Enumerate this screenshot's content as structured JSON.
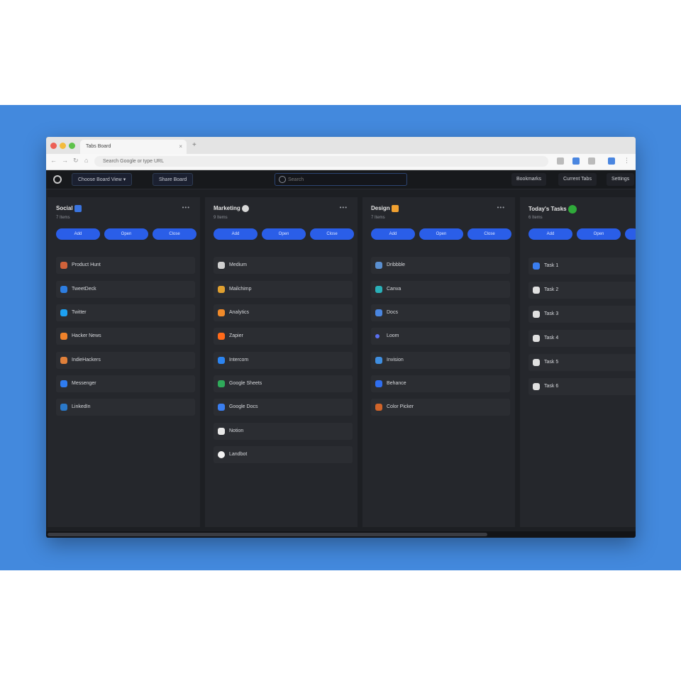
{
  "browser": {
    "tab_title": "Tabs Board",
    "new_tab": "+",
    "close_tab": "×",
    "url": "Search Google or type URL"
  },
  "toolbar": {
    "board_select": "Choose Board View",
    "share_board": "Share Board",
    "search_placeholder": "Search",
    "right_buttons": [
      "Bookmarks",
      "Current Tabs",
      "Settings"
    ]
  },
  "actions": [
    "Add",
    "Open",
    "Close"
  ],
  "columns": [
    {
      "title": "Social",
      "emoji_color": "#3a74e0",
      "subtitle": "7 Items",
      "menu": "•••",
      "items": [
        {
          "label": "Product Hunt",
          "color": "#d0623a"
        },
        {
          "label": "TweetDeck",
          "color": "#2d7de0"
        },
        {
          "label": "Twitter",
          "color": "#1da1f2"
        },
        {
          "label": "Hacker News",
          "color": "#f0822a"
        },
        {
          "label": "IndieHackers",
          "color": "#e0803a"
        },
        {
          "label": "Messenger",
          "color": "#2f7cf0"
        },
        {
          "label": "LinkedIn",
          "color": "#2a78c8"
        }
      ]
    },
    {
      "title": "Marketing",
      "emoji_color": "#d8d8d8",
      "subtitle": "9 Items",
      "menu": "•••",
      "items": [
        {
          "label": "Medium",
          "color": "#d0d0d0"
        },
        {
          "label": "Mailchimp",
          "color": "#e0a030"
        },
        {
          "label": "Analytics",
          "color": "#f08a2a"
        },
        {
          "label": "Zapier",
          "color": "#ff6a1a"
        },
        {
          "label": "Intercom",
          "color": "#2c84f0"
        },
        {
          "label": "Google Sheets",
          "color": "#2faa5a"
        },
        {
          "label": "Google Docs",
          "color": "#3a7ef0"
        },
        {
          "label": "Notion",
          "color": "#e8e8e8"
        },
        {
          "label": "Landbot",
          "color": "#f2f2f2"
        }
      ]
    },
    {
      "title": "Design",
      "emoji_color": "#f0a030",
      "subtitle": "7 Items",
      "menu": "•••",
      "items": [
        {
          "label": "Dribbble",
          "color": "#5a8fd0"
        },
        {
          "label": "Canva",
          "color": "#2ab0b8"
        },
        {
          "label": "Docs",
          "color": "#4a86e0"
        },
        {
          "label": "Loom",
          "color": "#5a6ff0"
        },
        {
          "label": "Invision",
          "color": "#3f8ee0"
        },
        {
          "label": "Behance",
          "color": "#2f6ef0"
        },
        {
          "label": "Color Picker",
          "color": "#d0642a"
        }
      ]
    },
    {
      "title": "Today's Tasks",
      "emoji_color": "#2faa3a",
      "subtitle": "6 Items",
      "menu": "",
      "items": [
        {
          "label": "Task 1",
          "color": "#3a7ef0"
        },
        {
          "label": "Task 2",
          "color": "#e0e0e0"
        },
        {
          "label": "Task 3",
          "color": "#e0e0e0"
        },
        {
          "label": "Task 4",
          "color": "#e0e0e0"
        },
        {
          "label": "Task 5",
          "color": "#e0e0e0"
        },
        {
          "label": "Task 6",
          "color": "#e0e0e0"
        }
      ]
    }
  ]
}
